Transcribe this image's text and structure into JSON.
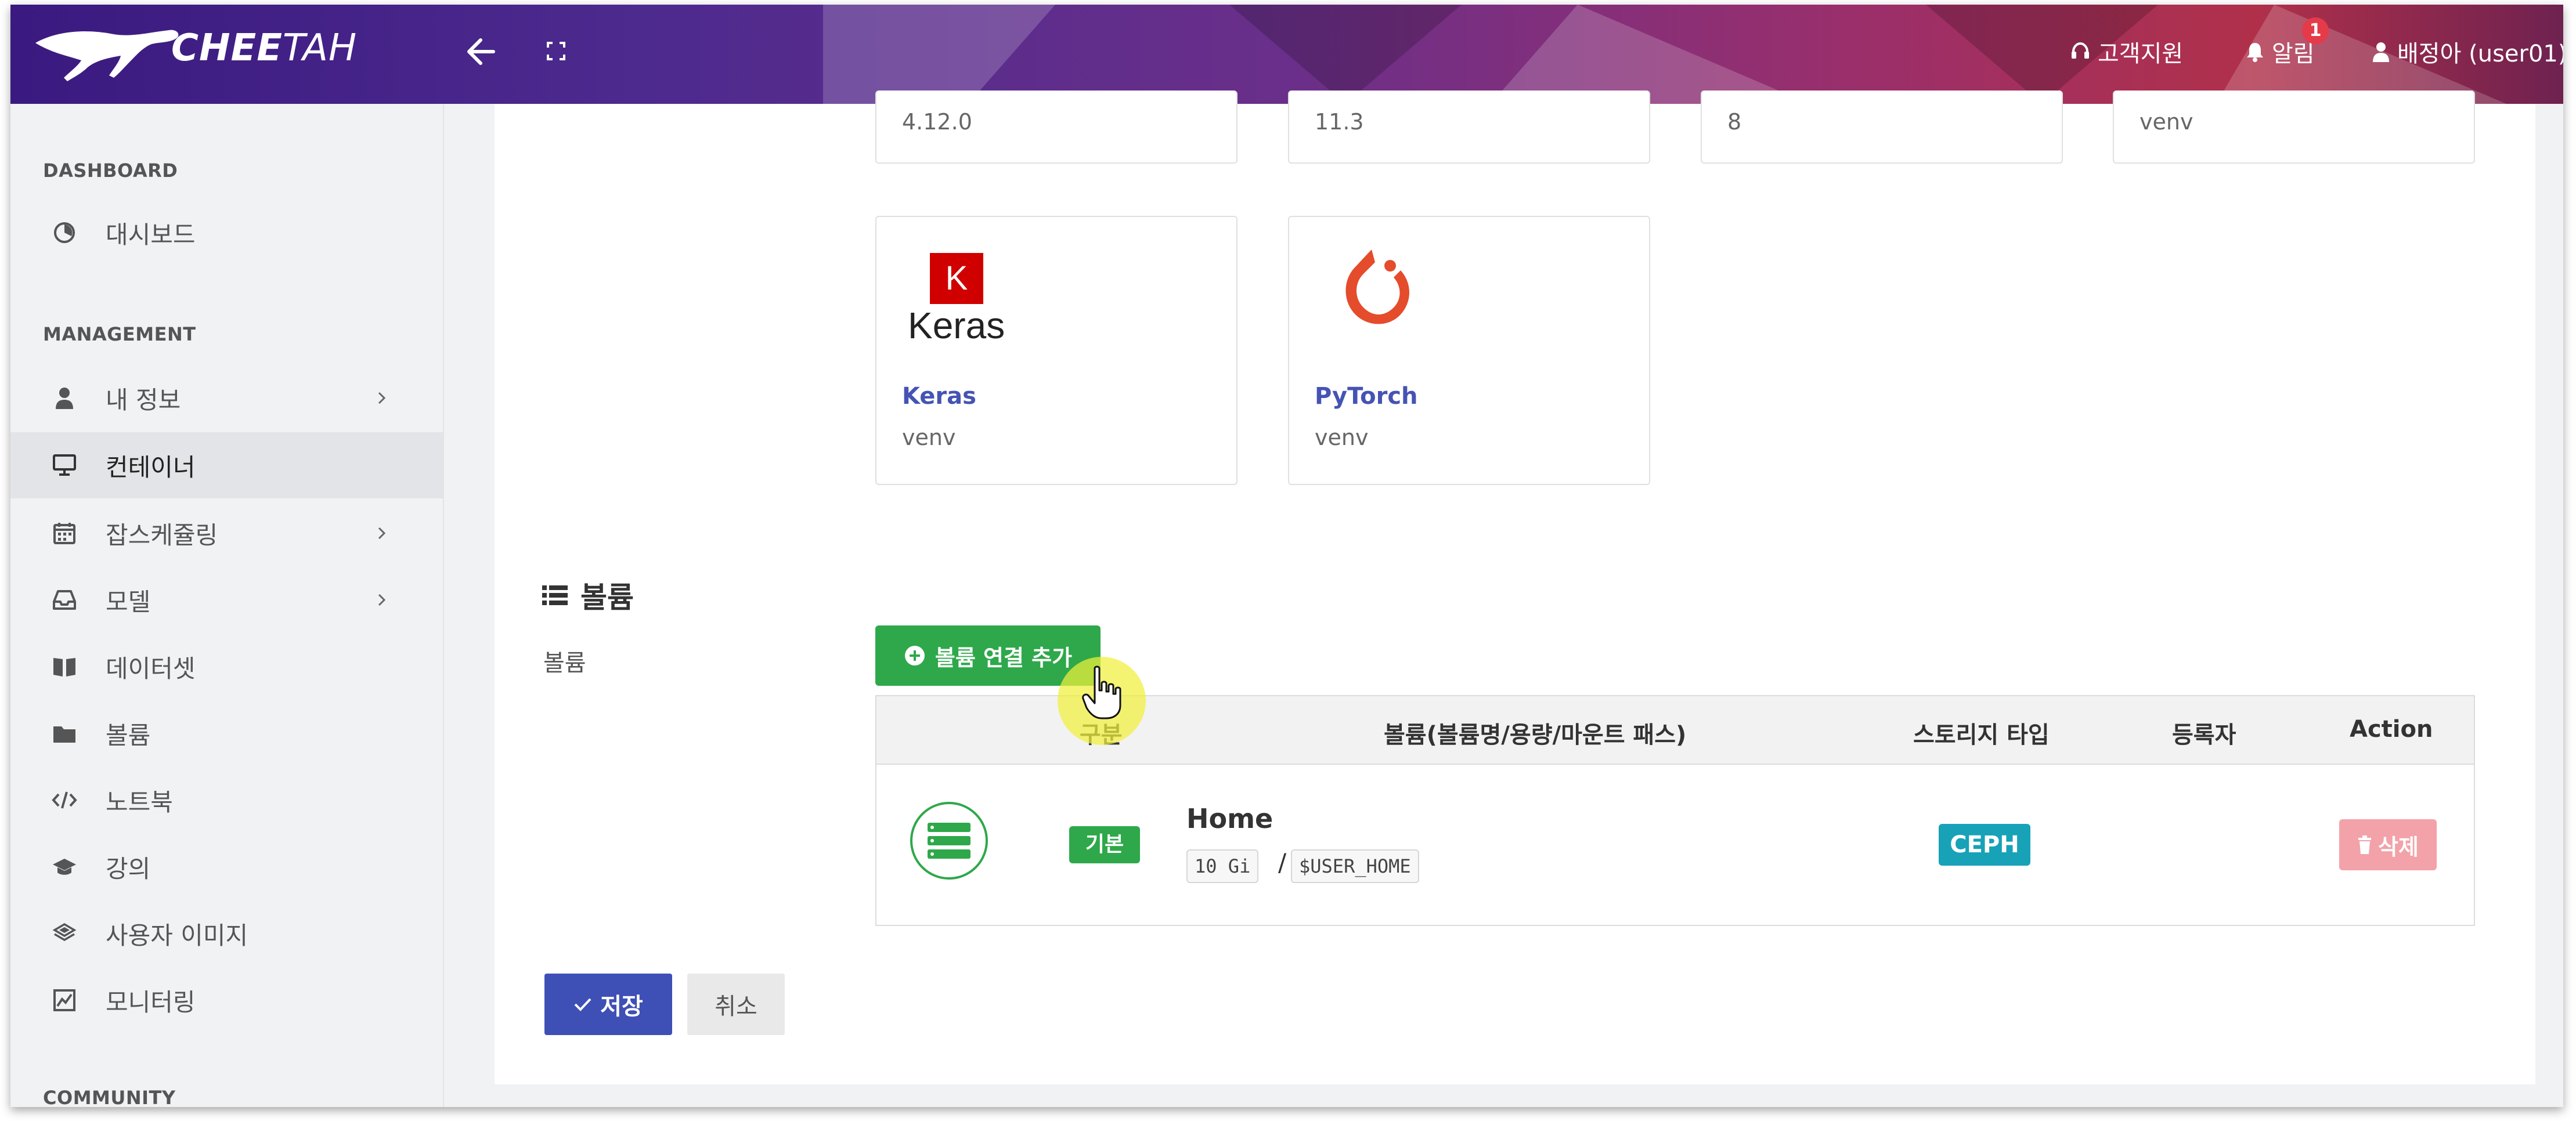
{
  "header": {
    "logo_bold": "CHEE",
    "logo_light": "TAH",
    "support": "고객지원",
    "alerts": "알림",
    "alerts_badge": "1",
    "user": "배정아 (user01)",
    "gradient_colors": [
      "#3a1a80",
      "#6a2f8a",
      "#b0304a"
    ]
  },
  "sidebar": {
    "sections": [
      "DASHBOARD",
      "MANAGEMENT",
      "COMMUNITY"
    ],
    "items": [
      {
        "label": "대시보드",
        "icon": "dashboard-icon"
      },
      {
        "label": "내 정보",
        "icon": "user-icon",
        "has_submenu": true
      },
      {
        "label": "컨테이너",
        "icon": "monitor-icon",
        "active": true
      },
      {
        "label": "잡스케쥴링",
        "icon": "calendar-icon",
        "has_submenu": true
      },
      {
        "label": "모델",
        "icon": "inbox-icon",
        "has_submenu": true
      },
      {
        "label": "데이터셋",
        "icon": "book-icon"
      },
      {
        "label": "볼륨",
        "icon": "folder-icon"
      },
      {
        "label": "노트북",
        "icon": "code-icon"
      },
      {
        "label": "강의",
        "icon": "graduation-cap-icon"
      },
      {
        "label": "사용자 이미지",
        "icon": "layers-icon"
      },
      {
        "label": "모니터링",
        "icon": "chart-area-icon"
      }
    ]
  },
  "frameworks": {
    "top_row_versions": [
      "4.12.0",
      "11.3",
      "8",
      "venv"
    ],
    "cards": [
      {
        "name": "Keras",
        "sub": "venv",
        "logo_letter": "K",
        "logo_word": "Keras"
      },
      {
        "name": "PyTorch",
        "sub": "venv"
      }
    ]
  },
  "volume_section": {
    "title": "볼륨",
    "label": "볼륨",
    "add_button": "볼륨 연결 추가",
    "columns": [
      "구분",
      "볼륨(볼륨명/용량/마운트 패스)",
      "스토리지 타입",
      "등록자",
      "Action"
    ],
    "rows": [
      {
        "type_tag": "기본",
        "name": "Home",
        "size": "10 Gi",
        "mount_path": "$USER_HOME",
        "storage": "CEPH",
        "owner": "",
        "delete_label": "삭제"
      }
    ]
  },
  "form": {
    "save": "저장",
    "cancel": "취소"
  }
}
